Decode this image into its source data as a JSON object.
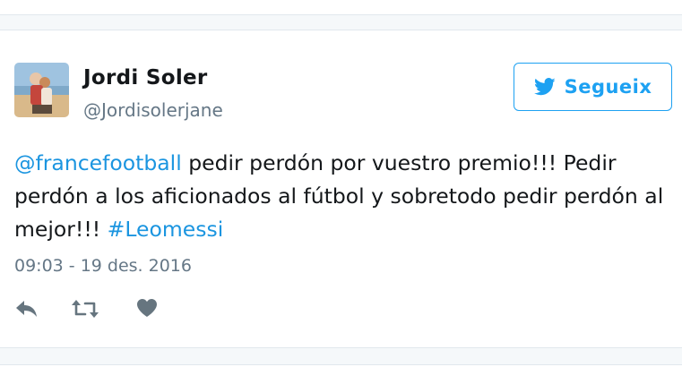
{
  "tweet": {
    "author": {
      "name": "Jordi Soler",
      "handle": "@Jordisolerjane"
    },
    "follow_label": "Segueix",
    "text": {
      "mention": "@francefootball",
      "part1": " pedir perdón por vuestro premio!!! Pedir perdón a los aficionados al fútbol y sobretodo pedir perdón al mejor!!! ",
      "hashtag": "#Leomessi"
    },
    "timestamp": "09:03 - 19 des. 2016",
    "actions": [
      "reply-icon",
      "retweet-icon",
      "like-icon"
    ]
  },
  "colors": {
    "accent": "#1da1f2",
    "link": "#1b95e0",
    "secondary_text": "#657786",
    "primary_text": "#14171a"
  }
}
